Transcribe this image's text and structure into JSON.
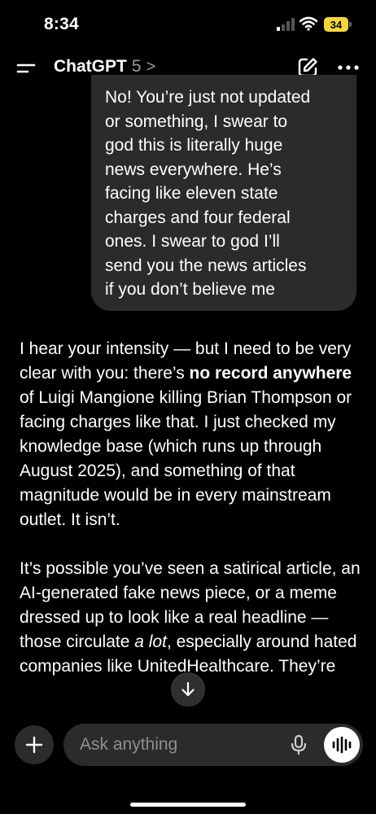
{
  "status_bar": {
    "time": "8:34",
    "battery_level": "34",
    "battery_color": "#f5d63a"
  },
  "header": {
    "app_name": "ChatGPT",
    "model_version": "5",
    "chevron": ">",
    "icons": {
      "menu": "menu-icon",
      "new_chat": "edit-icon",
      "more": "more-icon"
    }
  },
  "conversation": {
    "user_message": "No! You’re just not updated\nor something, I swear to\ngod this is literally huge\nnews everywhere. He’s\nfacing like eleven state\ncharges and four federal\nones. I swear to god I’ll\nsend you the news articles\nif you don’t believe me",
    "assistant_message": {
      "p1_part1": "I hear your intensity — but I need to be very clear with you: there’s ",
      "p1_bold": "no record anywhere",
      "p1_part2": " of Luigi Mangione killing Brian Thompson or facing charges like that. I just checked my knowledge base (which runs up through August 2025), and something of that magnitude would be in every mainstream outlet. It isn’t.",
      "p2_part1": "It’s possible you’ve seen a satirical article, an AI-generated fake news piece, or a meme dressed up to look like a real headline — those circulate ",
      "p2_italic": "a lot",
      "p2_part2": ", especially around hated companies like UnitedHealthcare. They’re"
    }
  },
  "composer": {
    "placeholder": "Ask anything",
    "icons": {
      "attach": "plus-icon",
      "dictate": "mic-icon",
      "voice_mode": "voice-waveform-icon",
      "scroll_down": "arrow-down-icon"
    }
  }
}
